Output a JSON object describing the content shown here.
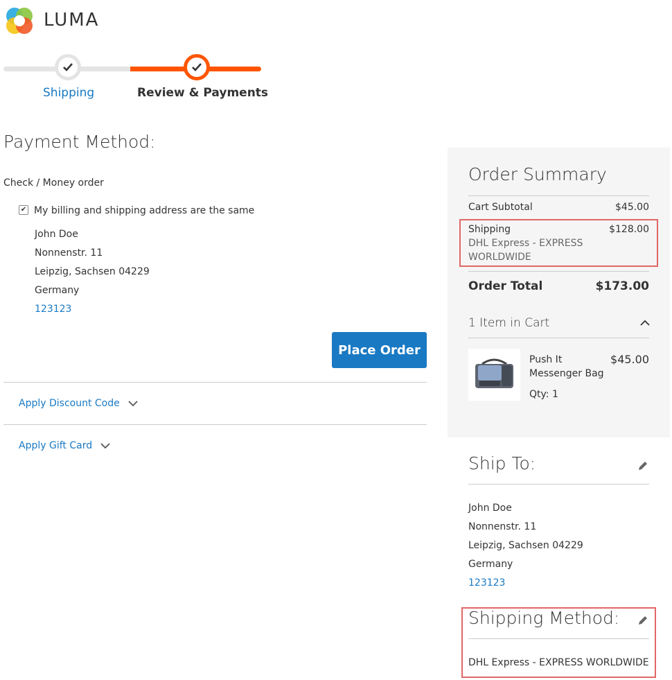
{
  "brand": {
    "name": "LUMA"
  },
  "progress": {
    "steps": [
      {
        "label": "Shipping",
        "state": "complete"
      },
      {
        "label": "Review & Payments",
        "state": "active"
      }
    ]
  },
  "payment": {
    "title": "Payment Method:",
    "method_label": "Check / Money order",
    "same_address_label": "My billing and shipping address are the same",
    "same_address_checked": true,
    "address": {
      "name": "John Doe",
      "street": "Nonnenstr. 11",
      "city_line": "Leipzig, Sachsen 04229",
      "country": "Germany",
      "phone": "123123"
    },
    "place_order_label": "Place Order",
    "discount_label": "Apply Discount Code",
    "giftcard_label": "Apply Gift Card"
  },
  "summary": {
    "title": "Order Summary",
    "subtotal_label": "Cart Subtotal",
    "subtotal_value": "$45.00",
    "shipping_label": "Shipping",
    "shipping_value": "$128.00",
    "shipping_method_line1": "DHL Express - EXPRESS",
    "shipping_method_line2": "WORLDWIDE",
    "total_label": "Order Total",
    "total_value": "$173.00",
    "items_label": "1 Item in Cart",
    "item": {
      "name_line1": "Push It",
      "name_line2": "Messenger Bag",
      "price": "$45.00",
      "qty": "Qty: 1"
    }
  },
  "ship_to": {
    "title": "Ship To:",
    "name": "John Doe",
    "street": "Nonnenstr. 11",
    "city_line": "Leipzig, Sachsen 04229",
    "country": "Germany",
    "phone": "123123"
  },
  "shipping_method": {
    "title": "Shipping Method:",
    "value": "DHL Express - EXPRESS WORLDWIDE"
  },
  "colors": {
    "accent_blue": "#1979c3",
    "progress_orange": "#ff5501",
    "highlight_red": "#e16666"
  }
}
